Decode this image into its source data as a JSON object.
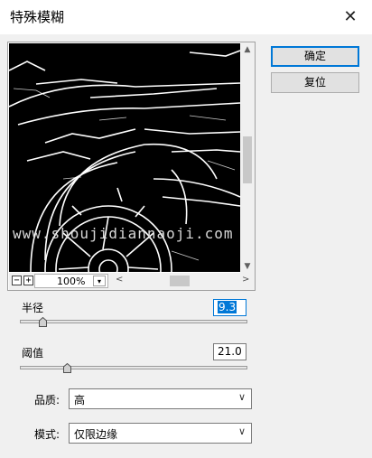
{
  "dialog": {
    "title": "特殊模糊",
    "close_glyph": "✕"
  },
  "preview": {
    "watermark": "www.shoujidiannaoji.com",
    "zoom_out": "−",
    "zoom_in": "+",
    "zoom_value": "100%",
    "dropdown_glyph": "▾",
    "scroll_left": "<",
    "scroll_right": ">",
    "scroll_up": "▲",
    "scroll_down": "▼"
  },
  "buttons": {
    "ok": "确定",
    "reset": "复位"
  },
  "radius": {
    "label": "半径",
    "value": "9.3",
    "slider_fraction": 0.1
  },
  "threshold": {
    "label": "阈值",
    "value": "21.0",
    "slider_fraction": 0.21
  },
  "quality": {
    "label": "品质:",
    "selected": "高"
  },
  "mode": {
    "label": "模式:",
    "selected": "仅限边缘"
  },
  "colors": {
    "accent": "#0078d7",
    "preview_bg": "#000000",
    "edge_lines": "#ffffff"
  }
}
